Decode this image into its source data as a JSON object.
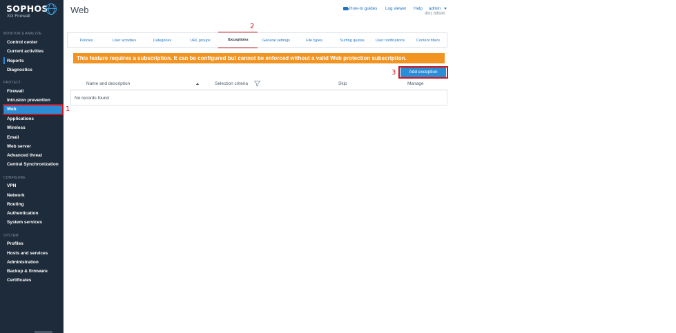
{
  "brand": {
    "name": "SOPHOS",
    "product": "XG Firewall"
  },
  "sidebar": {
    "sections": [
      {
        "title": "MONITOR & ANALYZE",
        "items": [
          "Control center",
          "Current activities",
          "Reports",
          "Diagnostics"
        ]
      },
      {
        "title": "PROTECT",
        "items": [
          "Firewall",
          "Intrusion prevention",
          "Web",
          "Applications",
          "Wireless",
          "Email",
          "Web server",
          "Advanced threat",
          "Central Synchronization"
        ]
      },
      {
        "title": "CONFIGURE",
        "items": [
          "VPN",
          "Network",
          "Routing",
          "Authentication",
          "System services"
        ]
      },
      {
        "title": "SYSTEM",
        "items": [
          "Profiles",
          "Hosts and services",
          "Administration",
          "Backup & firmware",
          "Certificates"
        ]
      }
    ],
    "active_item": "Web"
  },
  "header": {
    "title": "Web",
    "links": {
      "howto": "How-to guides",
      "log_viewer": "Log viewer",
      "help": "Help",
      "user": "admin"
    },
    "host": "dmz bilisim"
  },
  "tabs": [
    "Policies",
    "User activities",
    "Categories",
    "URL groups",
    "Exceptions",
    "General settings",
    "File types",
    "Surfing quotas",
    "User notifications",
    "Content filters"
  ],
  "active_tab": "Exceptions",
  "warning": "This feature requires a subscription. It can be configured but cannot be enforced without a valid Web protection subscription.",
  "add_button": "Add exception",
  "table": {
    "columns": [
      "Name and description",
      "Selection criteria",
      "Skip",
      "Manage"
    ],
    "empty_text": "No records found"
  },
  "annotations": [
    "1",
    "2",
    "3"
  ],
  "colors": {
    "sidebar_bg": "#1d2b3a",
    "accent": "#2b8dd6",
    "warning": "#f29422",
    "highlight": "#d0121b",
    "link": "#1f74c0"
  },
  "icons": {
    "howto": "video-camera-icon",
    "user_menu": "chevron-down-icon",
    "sort": "sort-ascending-icon",
    "filter": "filter-icon",
    "logo": "sophos-globe-icon"
  }
}
